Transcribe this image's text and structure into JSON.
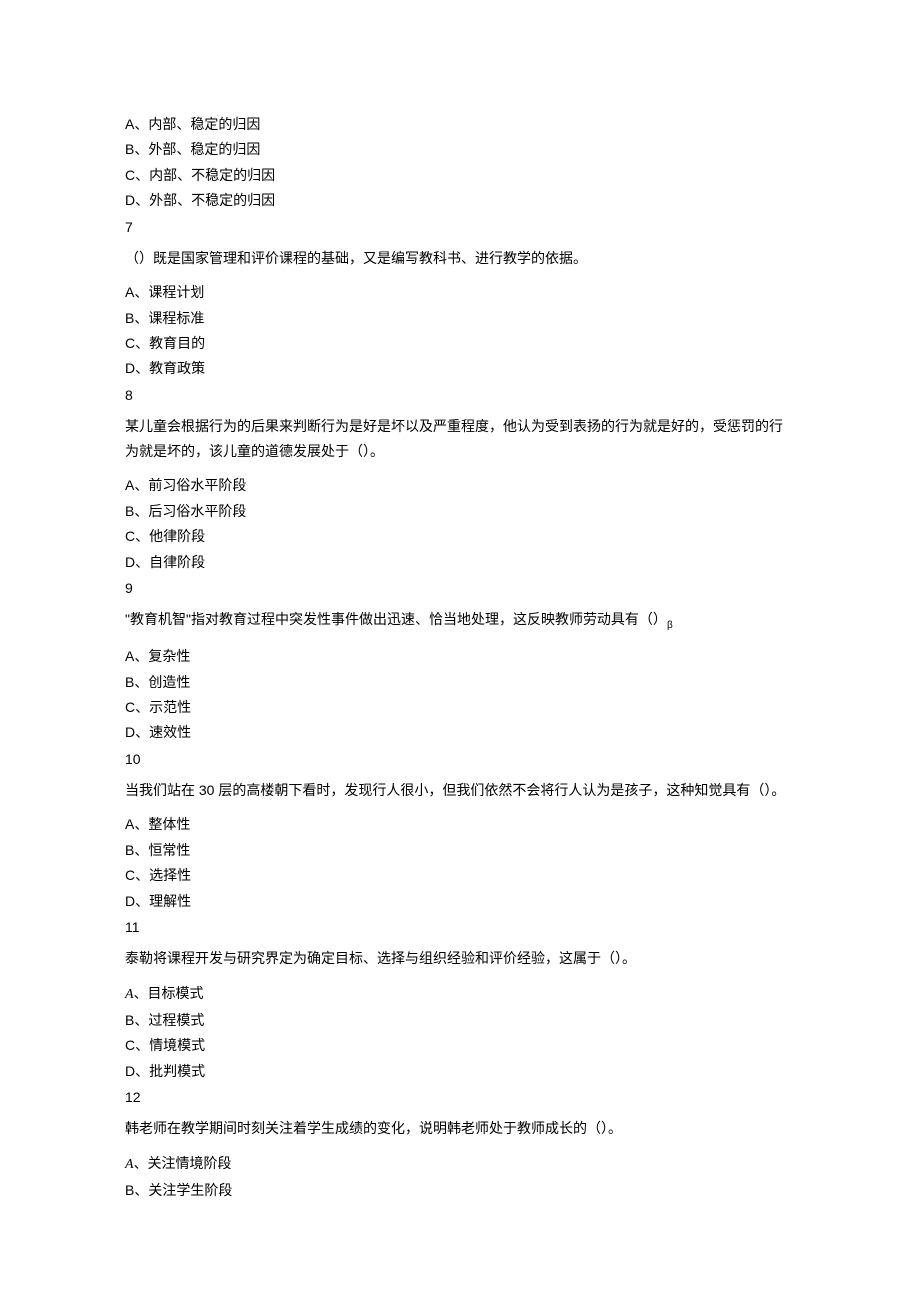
{
  "q6": {
    "optA": "A、内部、稳定的归因",
    "optB": "B、外部、稳定的归因",
    "optC": "C、内部、不稳定的归因",
    "optD": "D、外部、不稳定的归因"
  },
  "q7": {
    "num": "7",
    "stem": "（）既是国家管理和评价课程的基础，又是编写教科书、进行教学的依据。",
    "optA": "A、课程计划",
    "optB": "B、课程标准",
    "optC": "C、教育目的",
    "optD": "D、教育政策"
  },
  "q8": {
    "num": "8",
    "stem": "某儿童会根据行为的后果来判断行为是好是坏以及严重程度，他认为受到表扬的行为就是好的，受惩罚的行为就是坏的，该儿童的道德发展处于（）。",
    "optA": "A、前习俗水平阶段",
    "optB": "B、后习俗水平阶段",
    "optC": "C、他律阶段",
    "optD": "D、自律阶段"
  },
  "q9": {
    "num": "9",
    "stem_main": "\"教育机智\"指对教育过程中突发性事件做出迅速、恰当地处理，这反映教师劳动具有（）",
    "stem_sub": "β",
    "optA": "A、复杂性",
    "optB": "B、创造性",
    "optC": "C、示范性",
    "optD": "D、速效性"
  },
  "q10": {
    "num": "10",
    "stem": "当我们站在 30 层的高楼朝下看时，发现行人很小，但我们依然不会将行人认为是孩子，这种知觉具有（）。",
    "optA": "A、整体性",
    "optB": "B、恒常性",
    "optC": "C、选择性",
    "optD": "D、理解性"
  },
  "q11": {
    "num": "11",
    "stem": "泰勒将课程开发与研究界定为确定目标、选择与组织经验和评价经验，这属于（）。",
    "optA_letter": "A",
    "optA_text": "、目标模式",
    "optB": "B、过程模式",
    "optC": "C、情境模式",
    "optD": "D、批判模式"
  },
  "q12": {
    "num": "12",
    "stem": "韩老师在教学期间时刻关注着学生成绩的变化，说明韩老师处于教师成长的（）。",
    "optA_letter": "A",
    "optA_text": "、关注情境阶段",
    "optB": "B、关注学生阶段"
  }
}
